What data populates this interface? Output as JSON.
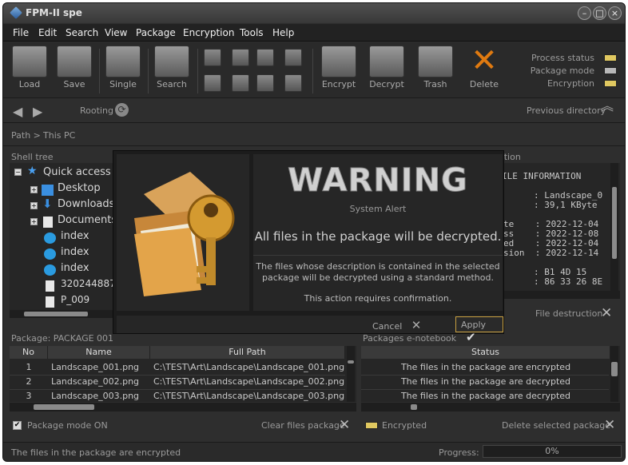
{
  "window": {
    "title": "FPM-II spe"
  },
  "menu": [
    "File",
    "Edit",
    "Search",
    "View",
    "Package",
    "Encryption",
    "Tools",
    "Help"
  ],
  "toolbar": {
    "load": "Load",
    "save": "Save",
    "single": "Single",
    "search": "Search",
    "encrypt": "Encrypt",
    "decrypt": "Decrypt",
    "trash": "Trash",
    "delete": "Delete"
  },
  "indicators": [
    {
      "label": "Process status",
      "color": "#e0c860"
    },
    {
      "label": "Package mode",
      "color": "#b8b8b8"
    },
    {
      "label": "Encryption",
      "color": "#e0c860"
    }
  ],
  "nav": {
    "rooting": "Rooting",
    "previous": "Previous directory"
  },
  "path": {
    "label": "Path >",
    "value": "This PC"
  },
  "shell_tree": {
    "header": "Shell tree",
    "items": [
      "Quick access",
      "Desktop",
      "Downloads",
      "Documents",
      "index",
      "index",
      "index",
      "320244887_",
      "P_009"
    ]
  },
  "info": {
    "header": "ation",
    "title": "ILE INFORMATION",
    "lines": [
      ": Landscape_0",
      ": 39,1 KByte",
      "te    : 2022-12-04",
      "ss    : 2022-12-08",
      "ed    : 2022-12-04",
      "sion  : 2022-12-14",
      ": B1 4D 15",
      ": 86 33 26 8E"
    ]
  },
  "file_destruction": "File destruction",
  "dialog": {
    "warning": "WARNING",
    "subtitle": "System Alert",
    "main": "All files in the package will be decrypted.",
    "desc1": "The files whose description is contained in the selected",
    "desc2": "package will be decrypted using a standard method.",
    "desc3": "This action requires confirmation.",
    "cancel": "Cancel",
    "apply": "Apply"
  },
  "package": {
    "header": "Package: PACKAGE 001",
    "cols": [
      "No",
      "Name",
      "Full Path"
    ],
    "rows": [
      [
        "1",
        "Landscape_001.png",
        "C:\\TEST\\Art\\Landscape\\Landscape_001.png"
      ],
      [
        "2",
        "Landscape_002.png",
        "C:\\TEST\\Art\\Landscape\\Landscape_002.png"
      ],
      [
        "3",
        "Landscape_003.png",
        "C:\\TEST\\Art\\Landscape\\Landscape_003.png"
      ]
    ],
    "mode_on": "Package mode ON",
    "clear": "Clear files package"
  },
  "notebook": {
    "header": "Packages e-notebook",
    "col": "Status",
    "rows": [
      "The files in the package are encrypted",
      "The files in the package are decrypted",
      "The files in the package are decrypted"
    ],
    "encrypted": "Encrypted",
    "delete": "Delete selected  package"
  },
  "status": {
    "text": "The files in the package are encrypted",
    "progress_label": "Progress:",
    "progress_value": "0%"
  }
}
